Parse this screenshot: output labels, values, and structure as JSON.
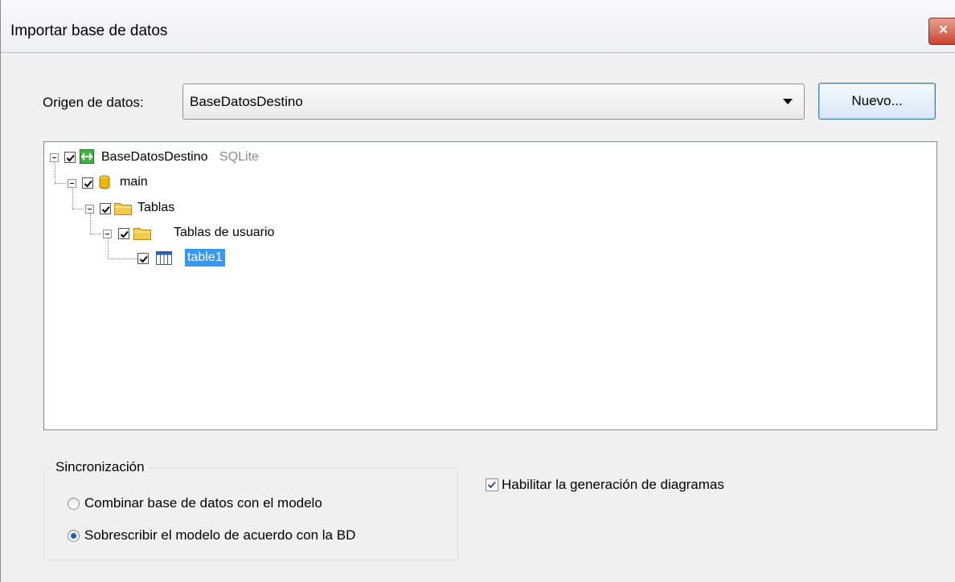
{
  "window": {
    "title": "Importar base de datos",
    "close_glyph": "×"
  },
  "datasource": {
    "label": "Origen de datos:",
    "selected": "BaseDatosDestino",
    "new_button": "Nuevo..."
  },
  "tree": {
    "nodes": [
      {
        "label": "BaseDatosDestino",
        "sublabel": "SQLite",
        "icon": "database-connection-icon",
        "checked": true,
        "expanded": true
      },
      {
        "label": "main",
        "icon": "database-schema-icon",
        "checked": true,
        "expanded": true
      },
      {
        "label": "Tablas",
        "icon": "folder-icon",
        "checked": true,
        "expanded": true
      },
      {
        "label": "Tablas de usuario",
        "icon": "folder-icon",
        "checked": true,
        "expanded": true
      },
      {
        "label": "table1",
        "icon": "table-icon",
        "checked": true,
        "selected": true
      }
    ]
  },
  "sync": {
    "legend": "Sincronización",
    "options": [
      {
        "label": "Combinar base de datos con el modelo",
        "selected": false
      },
      {
        "label": "Sobrescribir el modelo de acuerdo con la BD",
        "selected": true
      }
    ]
  },
  "diagram": {
    "label": "Habilitar la generación de diagramas",
    "checked": true
  },
  "colors": {
    "selection": "#3399ff",
    "folder": "#f5c94a",
    "db": "#f0b400",
    "conn": "#3fb33f"
  }
}
